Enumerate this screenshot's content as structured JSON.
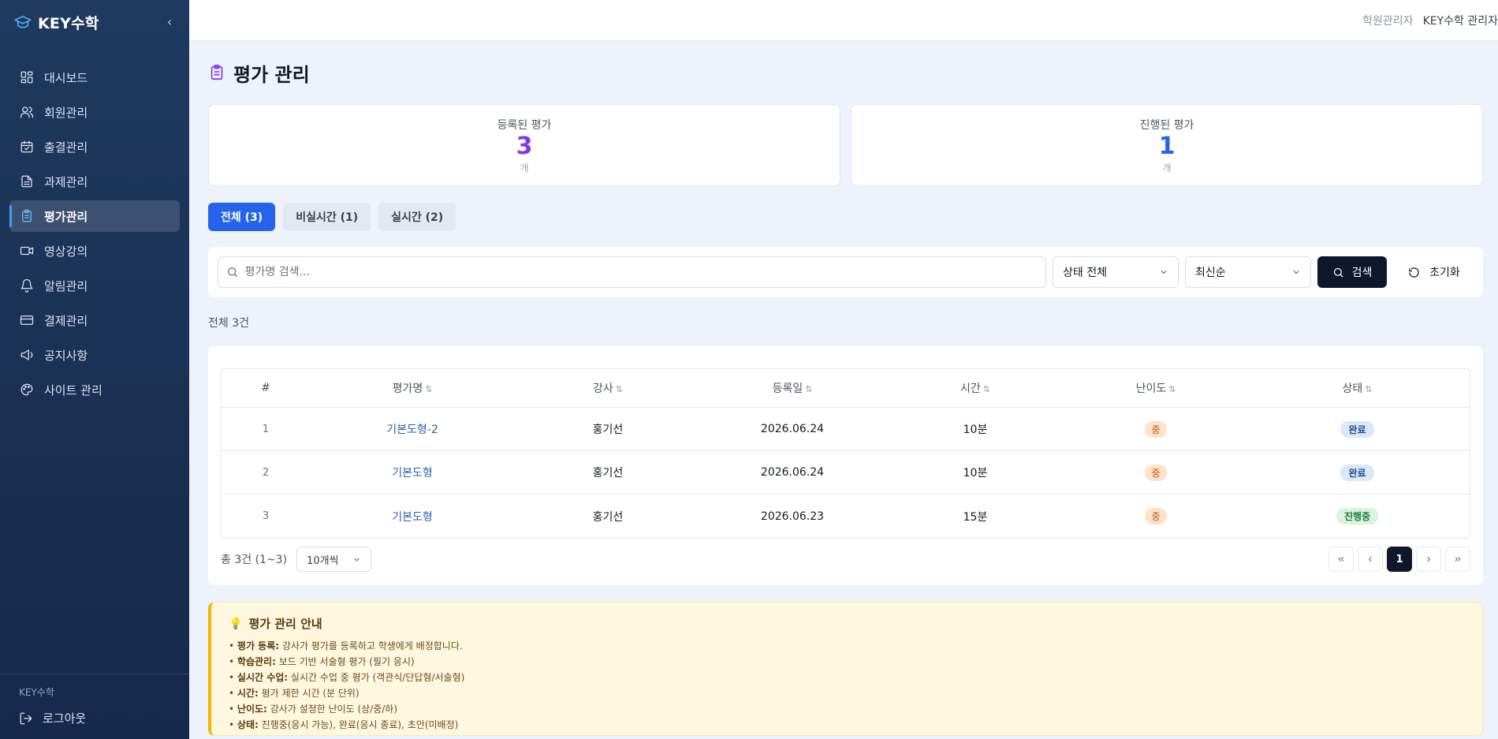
{
  "brand": {
    "name": "KEY수학"
  },
  "sidebar": {
    "items": [
      {
        "label": "대시보드",
        "icon": "dashboard-icon",
        "active": false
      },
      {
        "label": "회원관리",
        "icon": "users-icon",
        "active": false
      },
      {
        "label": "출결관리",
        "icon": "calendar-check-icon",
        "active": false
      },
      {
        "label": "과제관리",
        "icon": "document-icon",
        "active": false
      },
      {
        "label": "평가관리",
        "icon": "clipboard-icon",
        "active": true
      },
      {
        "label": "영상강의",
        "icon": "video-icon",
        "active": false
      },
      {
        "label": "알림관리",
        "icon": "bell-icon",
        "active": false
      },
      {
        "label": "결제관리",
        "icon": "credit-card-icon",
        "active": false
      },
      {
        "label": "공지사항",
        "icon": "megaphone-icon",
        "active": false
      },
      {
        "label": "사이트 관리",
        "icon": "palette-icon",
        "active": false
      }
    ],
    "footer_brand": "KEY수학",
    "logout_label": "로그아웃"
  },
  "topbar": {
    "role": "학원관리자",
    "user": "KEY수학 관리자"
  },
  "page": {
    "title": "평가 관리"
  },
  "stats": [
    {
      "label": "등록된 평가",
      "value": "3",
      "unit": "개",
      "color": "#7c3aed"
    },
    {
      "label": "진행된 평가",
      "value": "1",
      "unit": "개",
      "color": "#2563eb"
    }
  ],
  "tabs": [
    {
      "label": "전체 (3)",
      "active": true
    },
    {
      "label": "비실시간 (1)",
      "active": false
    },
    {
      "label": "실시간 (2)",
      "active": false
    }
  ],
  "filters": {
    "search_placeholder": "평가명 검색...",
    "status_select": "상태 전체",
    "sort_select": "최신순",
    "search_button": "검색",
    "reset_button": "초기화"
  },
  "count_label": "전체 3건",
  "table": {
    "headers": [
      "#",
      "평가명",
      "강사",
      "등록일",
      "시간",
      "난이도",
      "상태"
    ],
    "rows": [
      {
        "num": "1",
        "title": "기본도형-2",
        "teacher": "홍기선",
        "date": "2026.06.24",
        "time": "10분",
        "difficulty": "중",
        "status": "완료"
      },
      {
        "num": "2",
        "title": "기본도형",
        "teacher": "홍기선",
        "date": "2026.06.24",
        "time": "10분",
        "difficulty": "중",
        "status": "완료"
      },
      {
        "num": "3",
        "title": "기본도형",
        "teacher": "홍기선",
        "date": "2026.06.23",
        "time": "15분",
        "difficulty": "중",
        "status": "진행중"
      }
    ],
    "total_label": "총 3건 (1~3)",
    "per_page": "10개씩",
    "current_page": "1"
  },
  "guide": {
    "title": "평가 관리 안내",
    "items": [
      {
        "key": "평가 등록:",
        "text": " 강사가 평가를 등록하고 학생에게 배정합니다."
      },
      {
        "key": "학습관리:",
        "text": " 보드 기반 서술형 평가 (필기 응시)"
      },
      {
        "key": "실시간 수업:",
        "text": " 실시간 수업 중 평가 (객관식/단답형/서술형)"
      },
      {
        "key": "시간:",
        "text": " 평가 제한 시간 (분 단위)"
      },
      {
        "key": "난이도:",
        "text": " 강사가 설정한 난이도 (상/중/하)"
      },
      {
        "key": "상태:",
        "text": " 진행중(응시 가능), 완료(응시 종료), 초안(미배정)"
      }
    ]
  }
}
